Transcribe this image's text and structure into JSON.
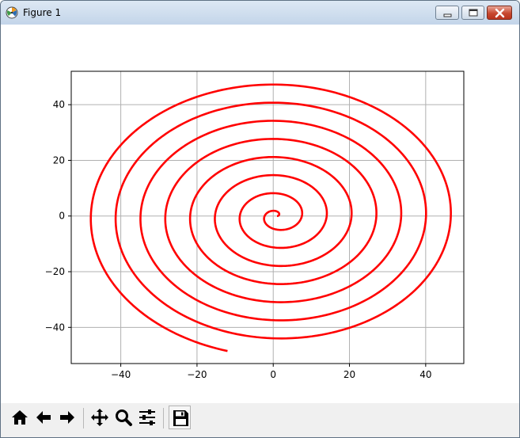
{
  "window": {
    "title": "Figure 1",
    "icon": "matplotlib-logo-icon",
    "controls": [
      "minimize-icon",
      "maximize-icon",
      "close-icon"
    ]
  },
  "toolbar": {
    "buttons": [
      {
        "name": "home",
        "icon": "home-icon"
      },
      {
        "name": "back",
        "icon": "arrow-left-icon"
      },
      {
        "name": "forward",
        "icon": "arrow-right-icon"
      },
      {
        "name": "pan",
        "icon": "move-arrows-icon"
      },
      {
        "name": "zoom",
        "icon": "magnifier-icon"
      },
      {
        "name": "subplots",
        "icon": "sliders-icon"
      },
      {
        "name": "save",
        "icon": "floppy-disk-icon"
      }
    ]
  },
  "chart_data": {
    "type": "line",
    "title": "",
    "xlabel": "",
    "ylabel": "",
    "xlim": [
      -53,
      50
    ],
    "ylim": [
      -53,
      52
    ],
    "xticks": [
      -40,
      -20,
      0,
      20,
      40
    ],
    "yticks": [
      -40,
      -20,
      0,
      20,
      40
    ],
    "xtick_labels": [
      "−40",
      "−20",
      "0",
      "20",
      "40"
    ],
    "ytick_labels": [
      "−40",
      "−20",
      "0",
      "20",
      "40"
    ],
    "grid": true,
    "series": [
      {
        "color": "#ff0000",
        "description": "Archimedean spiral starting near (1, 0) and growing outward with about 7.5 turns, ending near (-12, -48.5)",
        "start": [
          1,
          0
        ],
        "end": [
          -12,
          -48.5
        ],
        "turns": 7.5,
        "radial_growth_per_turn": 6.4
      }
    ]
  }
}
